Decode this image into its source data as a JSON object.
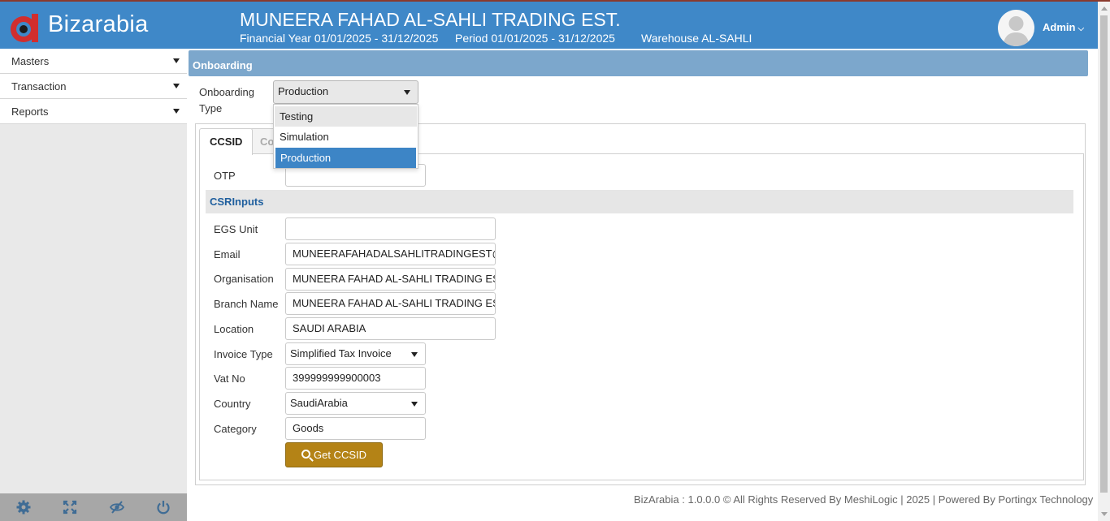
{
  "app": {
    "name": "Bizarabia"
  },
  "header": {
    "company": "MUNEERA FAHAD AL-SAHLI TRADING EST.",
    "financial_year": "Financial Year 01/01/2025 - 31/12/2025",
    "period": "Period 01/01/2025 - 31/12/2025",
    "warehouse": "Warehouse AL-SAHLI",
    "user": "Admin"
  },
  "sidebar": {
    "items": [
      {
        "label": "Masters"
      },
      {
        "label": "Transaction"
      },
      {
        "label": "Reports"
      }
    ],
    "footer_icons": [
      "settings-icon",
      "fullscreen-icon",
      "eye-slash-icon",
      "power-icon"
    ]
  },
  "page": {
    "section_title": "Onboarding",
    "onboarding_type_label_1": "Onboarding",
    "onboarding_type_label_2": "Type",
    "onboarding_type_value": "Production",
    "onboarding_type_options": [
      "Testing",
      "Simulation",
      "Production"
    ],
    "tabs": [
      {
        "label": "CCSID"
      },
      {
        "label": "Co"
      }
    ]
  },
  "form": {
    "otp_label": "OTP",
    "otp_value": "",
    "csr_title": "CSRInputs",
    "egs_label": "EGS Unit",
    "egs_value": "",
    "email_label": "Email",
    "email_value": "MUNEERAFAHADALSAHLITRADINGEST@gmail.com",
    "org_label": "Organisation",
    "org_value": "MUNEERA FAHAD AL-SAHLI TRADING EST.",
    "branch_label": "Branch Name",
    "branch_value": "MUNEERA FAHAD AL-SAHLI TRADING EST.",
    "location_label": "Location",
    "location_value": "SAUDI ARABIA",
    "invoice_type_label": "Invoice Type",
    "invoice_type_value": "Simplified Tax Invoice",
    "vat_label": "Vat No",
    "vat_value": "399999999900003",
    "country_label": "Country",
    "country_value": "SaudiArabia",
    "category_label": "Category",
    "category_value": "Goods",
    "submit_label": "Get CCSID"
  },
  "footer": {
    "text": "BizArabia : 1.0.0.0 © All Rights Reserved By MeshiLogic | 2025 | Powered By Portingx Technology"
  },
  "colors": {
    "header_blue": "#3f88c8",
    "section_bar": "#7ca7cc",
    "button_gold": "#b48316",
    "selected_option": "#3d85c6"
  }
}
